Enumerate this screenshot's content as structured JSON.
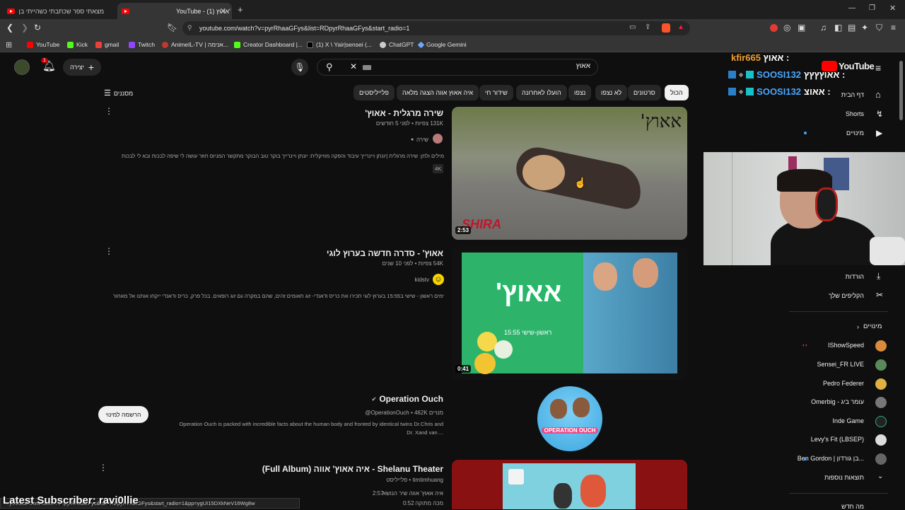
{
  "browser": {
    "tabs": [
      {
        "title": "מצאתי ספר שכתבתי כשהייתי בן 9..."
      },
      {
        "title": "YouTube - (1) אאוץ'"
      }
    ],
    "new_tab": "+",
    "url": "youtube.com/watch?v=pyrRhaaGFys&list=RDpyrRhaaGFys&start_radio=1",
    "bookmarks": [
      "YouTube",
      "Kick",
      "gmail",
      "Twitch",
      "AnimeIL-TV | אנימה...",
      "Creator Dashboard |...",
      "(1) X \\ Yair|sensei (...",
      "ChatGPT",
      "Google Gemini"
    ],
    "status_url": "youtube.com/watch?v=pyrRhaaGFys&list=RDpyrRhaaGFys&start_radio=1&pp=ygUI15DXkNeV16Wg8w..."
  },
  "youtube": {
    "logo_text": "YouTube",
    "search_value": "אאוץ",
    "create_label": "יצירה",
    "notif_count": "1",
    "filters_label": "מסננים",
    "chips": [
      "הכול",
      "סרטונים",
      "לא נצפו",
      "נצפו",
      "הועלו לאחרונה",
      "שידור חי",
      "איה אאוץ אווה הצגה מלאה",
      "פלייליסטים"
    ],
    "results": [
      {
        "title": "שירה מרגלית - אאוץ'",
        "meta": "131K צפיות • לפני 5 חודשים",
        "channel": "שירה",
        "desc": "מילים ולחן: שירה מרגלית |יונתן ויינרייך עיבוד והפקה מוזיקלית: יונתן ויינרייך בוקר טוב הבוקר מתקשר המניוס חוזר עושה לי שיפה לבכות ובא לי לבכות ...",
        "badge": "4K",
        "duration": "2:53",
        "thumb_text": "אאוץ'",
        "thumb_sign": "SHIRA"
      },
      {
        "title": "אאוץ' - סדרה חדשה בערוץ לוגי",
        "meta": "54K צפיות • לפני 10 שנים",
        "channel": "kidstv",
        "desc": "ימים ראשון - שישי ב15:55 בערוץ לוגי תכירו את כריס ודאנדי- זוג תאומים זהים, שהם במקרה גם זוג רופאים. בכל פרק, כריס ודאנדי ייקחו אותנו אל מאחורי ...",
        "duration": "0:41",
        "thumb_text": "אאוץ'",
        "thumb_sub": "ראשון-שישי 15:55"
      }
    ],
    "channel_result": {
      "name": "Operation Ouch",
      "meta": "@OperationOuch • 462K מנויים",
      "desc_line1": "Operation Ouch is packed with incredible facts about the human body and fronted by identical twins Dr.Chris and",
      "desc_line2": "Dr. Xand van ...",
      "subscribe": "הרשמה למינוי",
      "avatar_text": "OPERATION OUCH"
    },
    "playlist_result": {
      "title": "Shelanu Theater - איה אאוץ' אווה (Full Album)",
      "meta": "timtimhuang • פלייליסט",
      "track1_title": "איה אאוץ' אווה שיר הנושא",
      "track1_dur": "2:57",
      "track2_title": "מכה מתוקה",
      "track2_dur": "0:52"
    },
    "sidebar": {
      "items": [
        "דף הבית",
        "Shorts",
        "מינויים"
      ],
      "you_items": [
        "הורדות",
        "הקליפים שלך"
      ],
      "subs_header": "מינויים",
      "subs": [
        "IShowSpeed",
        "Sensei_FR LIVE",
        "Pedro Federer",
        "Omerbig - עומר ביג",
        "Inde Game",
        "Levy's Fit (LBSEP)",
        "Ben Gordon | בן גורדון..."
      ],
      "show_more": "תוצאות נוספות",
      "bottom_partial": "מה חדש"
    }
  },
  "stream_overlay": {
    "chat": [
      {
        "user": "kfir665",
        "text": "אאוץ :"
      },
      {
        "user": "SOOSI132",
        "text": "אאוץץץץ :"
      },
      {
        "user": "SOOSI132",
        "text": "אאוצ :"
      }
    ],
    "latest_subscriber": "Latest Subscriber: ravi0llie"
  },
  "colors": {
    "bg": "#0f0f0f",
    "chip": "#272727",
    "youtube_red": "#ff0000",
    "chat_user_orange": "#f0a030",
    "chat_user_blue": "#4aa8ff",
    "kidstv_green": "#2db46a"
  }
}
